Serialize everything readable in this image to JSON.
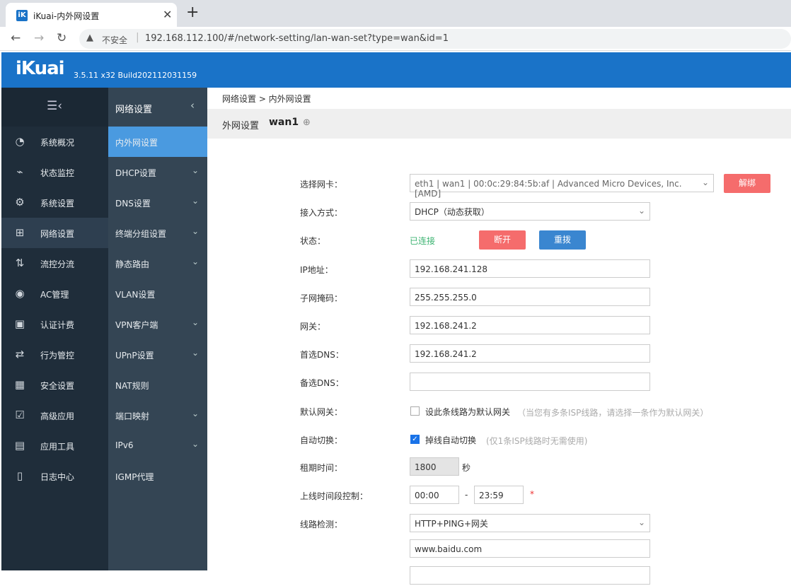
{
  "browser": {
    "tab_title": "iKuai-内外网设置",
    "favicon_text": "iK",
    "close_glyph": "✕",
    "newtab_glyph": "+",
    "back_glyph": "←",
    "forward_glyph": "→",
    "reload_glyph": "↻",
    "warning_glyph": "▲",
    "insecure_label": "不安全",
    "separator": "|",
    "url": "192.168.112.100/#/network-setting/lan-wan-set?type=wan&id=1"
  },
  "header": {
    "logo": "iKuai",
    "version": "3.5.11 x32 Build202112031159",
    "color": "#1a73c8"
  },
  "sidebar": {
    "toggle_glyph": "☰‹",
    "items": [
      {
        "label": "系统概况",
        "icon": "◔"
      },
      {
        "label": "状态监控",
        "icon": "⌁"
      },
      {
        "label": "系统设置",
        "icon": "⚙"
      },
      {
        "label": "网络设置",
        "icon": "⊞"
      },
      {
        "label": "流控分流",
        "icon": "⇅"
      },
      {
        "label": "AC管理",
        "icon": "◉"
      },
      {
        "label": "认证计费",
        "icon": "▣"
      },
      {
        "label": "行为管控",
        "icon": "⇄"
      },
      {
        "label": "安全设置",
        "icon": "▦"
      },
      {
        "label": "高级应用",
        "icon": "☑"
      },
      {
        "label": "应用工具",
        "icon": "▤"
      },
      {
        "label": "日志中心",
        "icon": "▯"
      }
    ]
  },
  "subnav": {
    "title": "网络设置",
    "collapse_glyph": "‹",
    "chevron_glyph": "⌄",
    "items": [
      {
        "label": "内外网设置"
      },
      {
        "label": "DHCP设置"
      },
      {
        "label": "DNS设置"
      },
      {
        "label": "终端分组设置"
      },
      {
        "label": "静态路由"
      },
      {
        "label": "VLAN设置"
      },
      {
        "label": "VPN客户端"
      },
      {
        "label": "UPnP设置"
      },
      {
        "label": "NAT规则"
      },
      {
        "label": "端口映射"
      },
      {
        "label": "IPv6"
      },
      {
        "label": "IGMP代理"
      }
    ]
  },
  "main": {
    "breadcrumb": "网络设置 > 内外网设置",
    "section_title": "外网设置",
    "wan_name": "wan1",
    "add_glyph": "⊕",
    "nic_label": "选择网卡：",
    "nic_value": "eth1 | wan1 | 00:0c:29:84:5b:af | Advanced Micro Devices, Inc. [AMD]",
    "unbind_label": "解绑",
    "access_label": "接入方式：",
    "access_value": "DHCP（动态获取）",
    "status_label": "状态：",
    "status_value": "已连接",
    "disconnect_label": "断开",
    "redial_label": "重拨",
    "ip_label": "IP地址：",
    "ip_value": "192.168.241.128",
    "mask_label": "子网掩码：",
    "mask_value": "255.255.255.0",
    "gw_label": "网关：",
    "gw_value": "192.168.241.2",
    "dns1_label": "首选DNS：",
    "dns1_value": "192.168.241.2",
    "dns2_label": "备选DNS：",
    "dns2_value": "",
    "defgw_label": "默认网关：",
    "defgw_cb_label": "设此条线路为默认网关",
    "defgw_hint": "（当您有多条ISP线路，请选择一条作为默认网关）",
    "autoswitch_label": "自动切换：",
    "autoswitch_cb_label": "掉线自动切换",
    "autoswitch_hint": "(仅1条ISP线路时无需使用)",
    "check_glyph": "✓",
    "lease_label": "租期时间：",
    "lease_value": "1800",
    "lease_unit": "秒",
    "online_label": "上线时间段控制：",
    "online_from": "00:00",
    "online_dash": "-",
    "online_to": "23:59",
    "required_mark": "*",
    "linecheck_label": "线路检测：",
    "linecheck_value": "HTTP+PING+网关",
    "linecheck_url": "www.baidu.com"
  },
  "colors": {
    "accent": "#1a73c8",
    "danger": "#f56c6c",
    "primary": "#3a86d0",
    "success": "#3cb371",
    "sidebar": "#1f2d3a",
    "subnav": "#344554",
    "subnav_active": "#4a9ae0"
  }
}
